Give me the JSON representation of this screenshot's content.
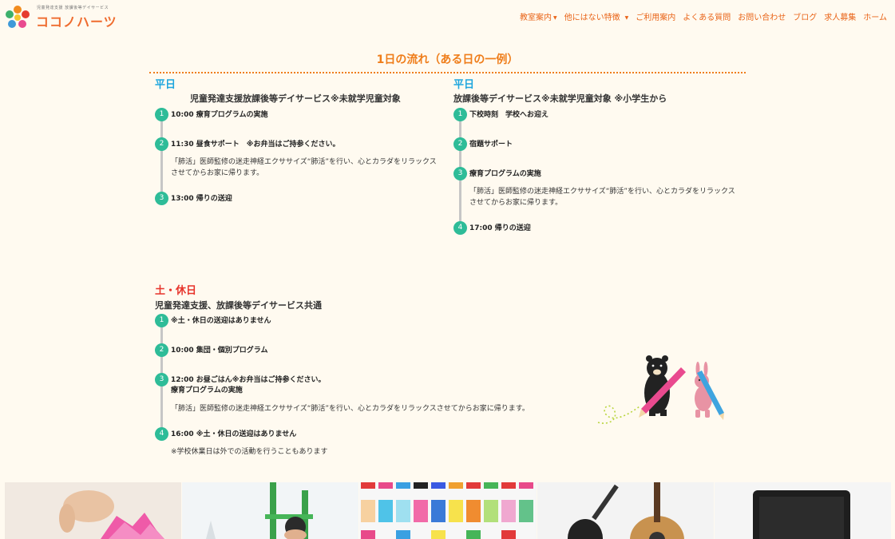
{
  "header": {
    "logo_tagline": "児童発達支援 放課後等デイサービス",
    "logo_text": "ココノハーツ",
    "nav": [
      {
        "label": "教室案内",
        "dropdown": true
      },
      {
        "label": "他にはない特徴",
        "dropdown": true
      },
      {
        "label": "ご利用案内",
        "dropdown": false
      },
      {
        "label": "よくある質問",
        "dropdown": false
      },
      {
        "label": "お問い合わせ",
        "dropdown": false
      },
      {
        "label": "ブログ",
        "dropdown": false
      },
      {
        "label": "求人募集",
        "dropdown": false
      },
      {
        "label": "ホーム",
        "dropdown": false
      }
    ]
  },
  "section_title": "1日の流れ（ある日の一例）",
  "weekday_left": {
    "heading": "平日",
    "subheading": "児童発達支援放課後等デイサービス※未就学児童対象",
    "steps": [
      {
        "num": "1",
        "title": "10:00 療育プログラムの実施",
        "desc": ""
      },
      {
        "num": "2",
        "title": "11:30 昼食サポート　※お弁当はご持参ください。",
        "desc": "「肺活」医師監修の迷走神経エクササイズ“肺活”を行い、心とカラダをリラックスさせてからお家に帰ります。"
      },
      {
        "num": "3",
        "title": "13:00 帰りの送迎",
        "desc": ""
      }
    ]
  },
  "weekday_right": {
    "heading": "平日",
    "subheading": "放課後等デイサービス※未就学児童対象 ※小学生から",
    "steps": [
      {
        "num": "1",
        "title": "下校時刻　学校へお迎え",
        "desc": ""
      },
      {
        "num": "2",
        "title": "宿題サポート",
        "desc": ""
      },
      {
        "num": "3",
        "title": "療育プログラムの実施",
        "desc": "「肺活」医師監修の迷走神経エクササイズ“肺活”を行い、心とカラダをリラックスさせてからお家に帰ります。"
      },
      {
        "num": "4",
        "title": "17:00 帰りの送迎",
        "desc": ""
      }
    ]
  },
  "holiday": {
    "heading": "土・休日",
    "subheading": "児童発達支援、放課後等デイサービス共通",
    "steps": [
      {
        "num": "1",
        "title": "※土・休日の送迎はありません",
        "desc": ""
      },
      {
        "num": "2",
        "title": "10:00 集団・個別プログラム",
        "desc": ""
      },
      {
        "num": "3",
        "title": "12:00 お昼ごはん※お弁当はご持参ください。",
        "title2": "療育プログラムの実施",
        "desc": "「肺活」医師監修の迷走神経エクササイズ“肺活”を行い、心とカラダをリラックスさせてからお家に帰ります。"
      },
      {
        "num": "4",
        "title": "16:00 ※土・休日の送迎はありません",
        "desc": "※学校休業日は外での活動を行うこともあります"
      }
    ]
  },
  "colors": {
    "accent_orange": "#ef7d1a",
    "weekday_blue": "#1ea6de",
    "holiday_red": "#e7342b",
    "step_green": "#2ebc98",
    "background": "#fffaf0"
  },
  "photos": [
    "kids-hands-craft",
    "child-on-playground",
    "colored-bottles",
    "guitar",
    "tablet-device"
  ]
}
